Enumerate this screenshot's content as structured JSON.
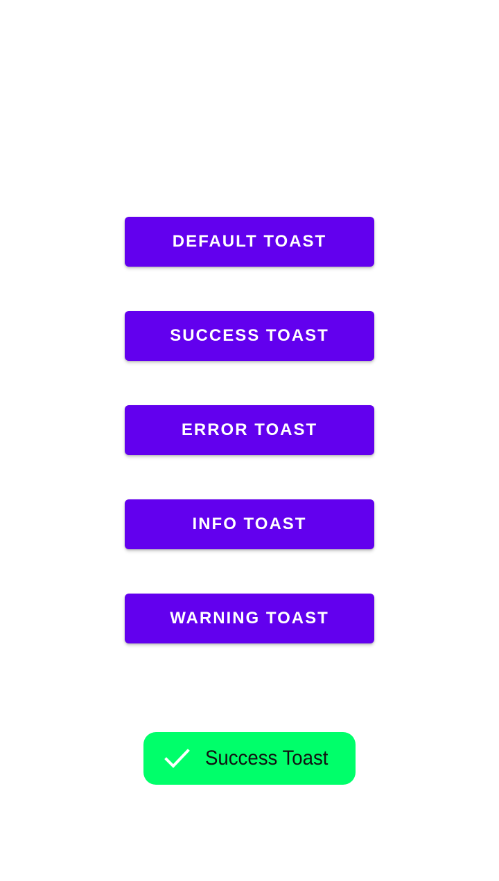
{
  "colors": {
    "button_bg": "#6200EE",
    "button_text": "#FFFFFF",
    "toast_bg": "#00FF6A",
    "toast_text": "#111111",
    "background": "#FFFFFF"
  },
  "buttons": [
    {
      "label": "DEFAULT TOAST"
    },
    {
      "label": "SUCCESS TOAST"
    },
    {
      "label": "ERROR TOAST"
    },
    {
      "label": "INFO TOAST"
    },
    {
      "label": "WARNING TOAST"
    }
  ],
  "toast": {
    "icon": "checkmark-icon",
    "message": "Success Toast"
  }
}
